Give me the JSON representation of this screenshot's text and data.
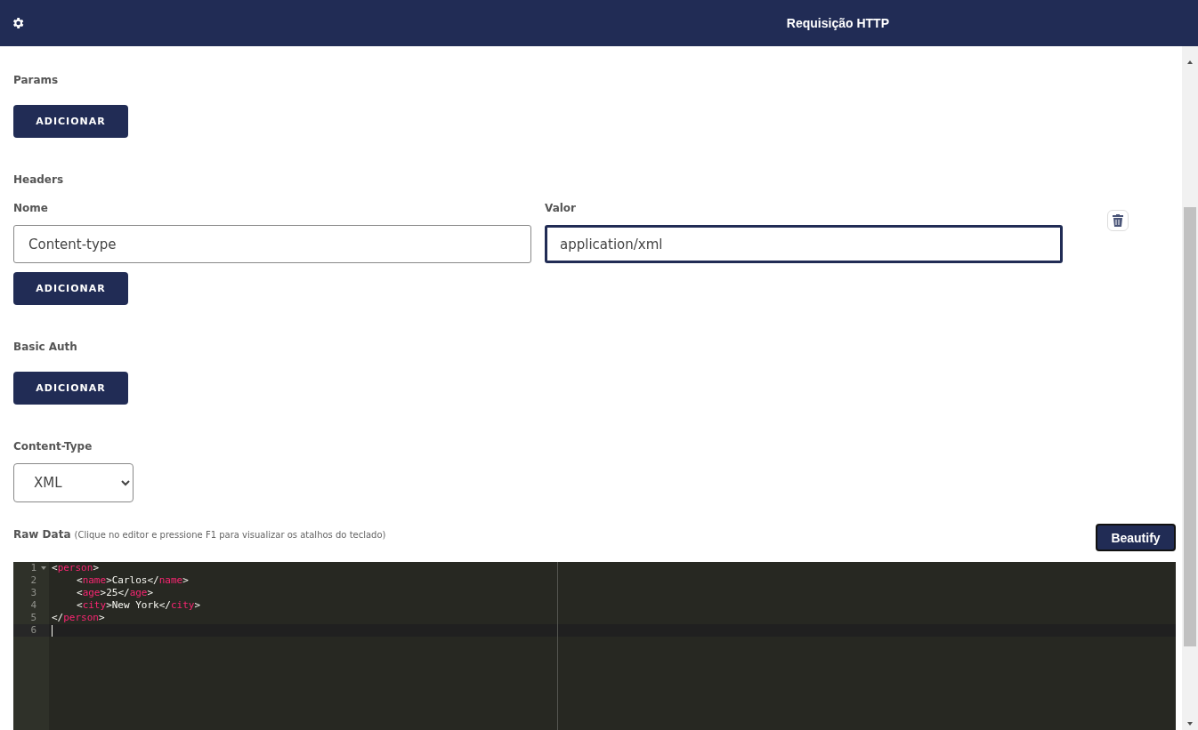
{
  "header": {
    "title": "Requisição HTTP"
  },
  "params": {
    "label": "Params",
    "button": "ADICIONAR"
  },
  "headers": {
    "label": "Headers",
    "name_label": "Nome",
    "value_label": "Valor",
    "rows": [
      {
        "name": "Content-type",
        "value": "application/xml",
        "focused": true
      }
    ],
    "button": "ADICIONAR"
  },
  "basic_auth": {
    "label": "Basic Auth",
    "button": "ADICIONAR"
  },
  "content_type": {
    "label": "Content-Type",
    "value": "XML"
  },
  "raw_data": {
    "label": "Raw Data",
    "hint": "(Clique no editor e pressione F1 para visualizar os atalhos do teclado)",
    "button": "Beautify"
  },
  "editor": {
    "lines": [
      {
        "number": "1",
        "foldable": true,
        "active": false,
        "tokens": [
          {
            "kind": "punct",
            "text": "<"
          },
          {
            "kind": "tag",
            "text": "person"
          },
          {
            "kind": "punct",
            "text": ">"
          }
        ],
        "children": [
          {
            "number": "2",
            "foldable": false,
            "active": false,
            "tokens": [
              {
                "kind": "punct",
                "text": "<"
              },
              {
                "kind": "tag",
                "text": "name"
              },
              {
                "kind": "punct",
                "text": ">"
              },
              {
                "kind": "text",
                "text": "Carlos"
              },
              {
                "kind": "punct",
                "text": "</"
              },
              {
                "kind": "tag",
                "text": "name"
              },
              {
                "kind": "punct",
                "text": ">"
              }
            ]
          },
          {
            "number": "3",
            "foldable": false,
            "active": false,
            "tokens": [
              {
                "kind": "punct",
                "text": "<"
              },
              {
                "kind": "tag",
                "text": "age"
              },
              {
                "kind": "punct",
                "text": ">"
              },
              {
                "kind": "text",
                "text": "25"
              },
              {
                "kind": "punct",
                "text": "</"
              },
              {
                "kind": "tag",
                "text": "age"
              },
              {
                "kind": "punct",
                "text": ">"
              }
            ]
          },
          {
            "number": "4",
            "foldable": false,
            "active": false,
            "tokens": [
              {
                "kind": "punct",
                "text": "<"
              },
              {
                "kind": "tag",
                "text": "city"
              },
              {
                "kind": "punct",
                "text": ">"
              },
              {
                "kind": "text",
                "text": "New York"
              },
              {
                "kind": "punct",
                "text": "</"
              },
              {
                "kind": "tag",
                "text": "city"
              },
              {
                "kind": "punct",
                "text": ">"
              }
            ]
          }
        ]
      },
      {
        "number": "5",
        "foldable": false,
        "active": false,
        "tokens": [
          {
            "kind": "punct",
            "text": "</"
          },
          {
            "kind": "tag",
            "text": "person"
          },
          {
            "kind": "punct",
            "text": ">"
          }
        ]
      },
      {
        "number": "6",
        "foldable": false,
        "active": true
      }
    ]
  }
}
